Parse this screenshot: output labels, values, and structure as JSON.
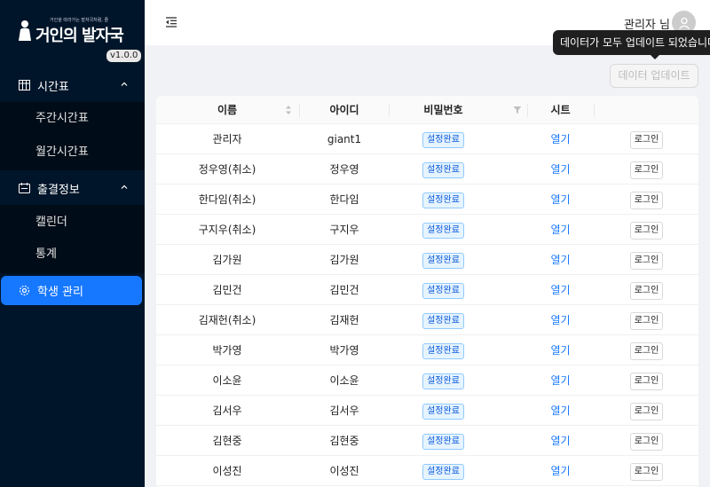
{
  "app": {
    "logo_text": "거인의 발자국",
    "logo_subtitle": "거인을 따라가는 발자국처럼, 즐",
    "version": "v1.0.0"
  },
  "sidebar": {
    "groups": [
      {
        "label": "시간표",
        "icon": "calendar-table-icon",
        "items": [
          {
            "label": "주간시간표"
          },
          {
            "label": "월간시간표"
          }
        ]
      },
      {
        "label": "출결정보",
        "icon": "attendance-icon",
        "items": [
          {
            "label": "캘린더"
          },
          {
            "label": "통계"
          }
        ]
      }
    ],
    "active_item": {
      "label": "학생 관리",
      "icon": "gear-icon"
    }
  },
  "header": {
    "user_label": "관리자 님"
  },
  "tooltip": {
    "text": "데이터가 모두 업데이트 되었습니다."
  },
  "toolbar": {
    "update_label": "데이터 업데이트"
  },
  "table": {
    "columns": [
      "이름",
      "아이디",
      "비밀번호",
      "시트",
      ""
    ],
    "rows": [
      {
        "name": "관리자",
        "id": "giant1",
        "password": "설정완료",
        "sheet": "열기",
        "action": "로그인"
      },
      {
        "name": "정우영(취소)",
        "id": "정우영",
        "password": "설정완료",
        "sheet": "열기",
        "action": "로그인"
      },
      {
        "name": "한다임(취소)",
        "id": "한다임",
        "password": "설정완료",
        "sheet": "열기",
        "action": "로그인"
      },
      {
        "name": "구지우(취소)",
        "id": "구지우",
        "password": "설정완료",
        "sheet": "열기",
        "action": "로그인"
      },
      {
        "name": "김가원",
        "id": "김가원",
        "password": "설정완료",
        "sheet": "열기",
        "action": "로그인"
      },
      {
        "name": "김민건",
        "id": "김민건",
        "password": "설정완료",
        "sheet": "열기",
        "action": "로그인"
      },
      {
        "name": "김재헌(취소)",
        "id": "김재헌",
        "password": "설정완료",
        "sheet": "열기",
        "action": "로그인"
      },
      {
        "name": "박가영",
        "id": "박가영",
        "password": "설정완료",
        "sheet": "열기",
        "action": "로그인"
      },
      {
        "name": "이소윤",
        "id": "이소윤",
        "password": "설정완료",
        "sheet": "열기",
        "action": "로그인"
      },
      {
        "name": "김서우",
        "id": "김서우",
        "password": "설정완료",
        "sheet": "열기",
        "action": "로그인"
      },
      {
        "name": "김현중",
        "id": "김현중",
        "password": "설정완료",
        "sheet": "열기",
        "action": "로그인"
      },
      {
        "name": "이성진",
        "id": "이성진",
        "password": "설정완료",
        "sheet": "열기",
        "action": "로그인"
      }
    ]
  },
  "colors": {
    "sidebar_bg": "#001529",
    "accent": "#1677ff",
    "tag_bg": "#e6f4ff"
  }
}
